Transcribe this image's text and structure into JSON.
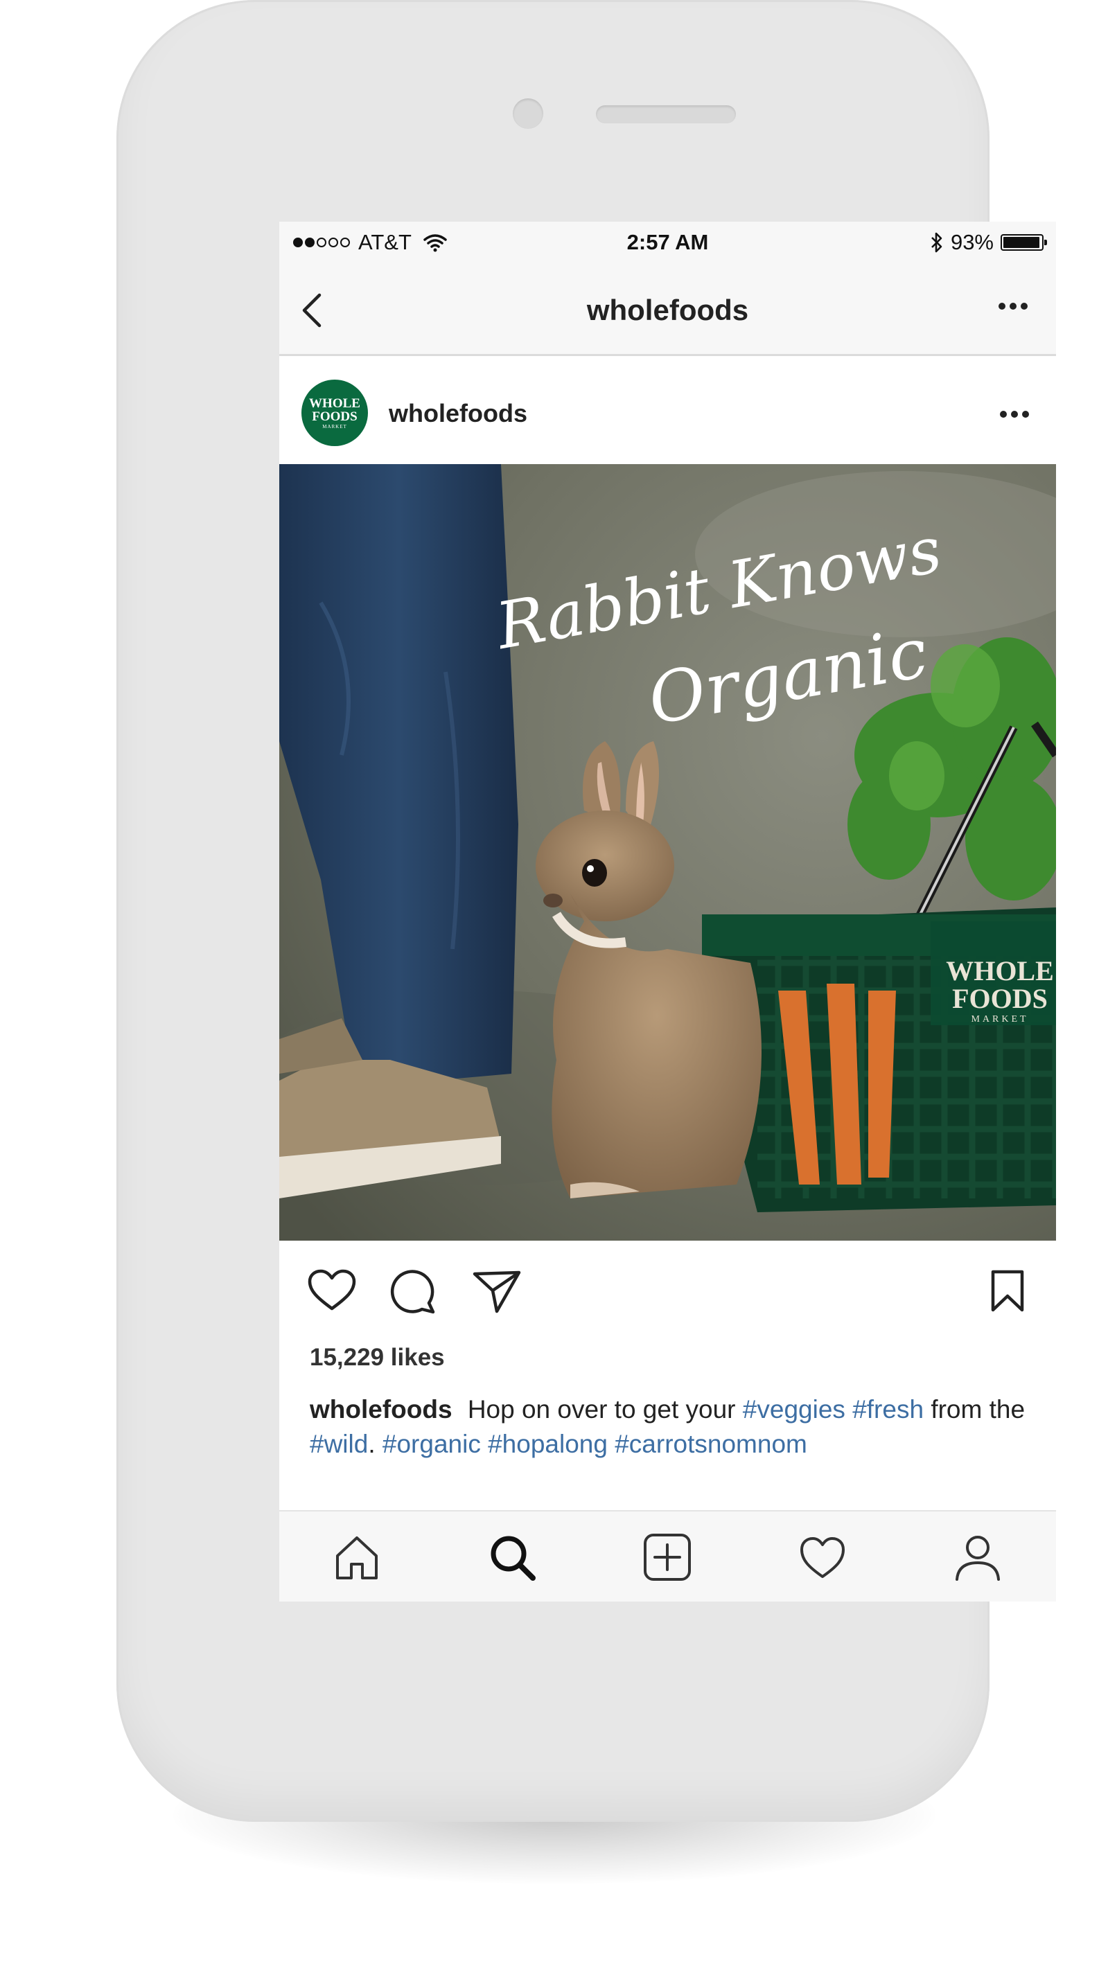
{
  "status_bar": {
    "carrier": "AT&T",
    "time": "2:57 AM",
    "battery": "93%",
    "battery_level": 0.93,
    "signal_bars_filled": 2,
    "signal_bars_total": 5
  },
  "nav": {
    "title": "wholefoods",
    "back_icon": "chevron-left-icon",
    "more_icon": "ellipsis-icon"
  },
  "post": {
    "username": "wholefoods",
    "avatar_logo": {
      "line1": "WHOLE",
      "line2": "FOODS",
      "line3": "MARKET",
      "color": "#0a6a3f"
    },
    "image": {
      "headline_line1": "Rabbit Knows",
      "headline_line2": "Organic",
      "basket_logo_line1": "WHOLE",
      "basket_logo_line2": "FOODS",
      "basket_logo_line3": "MARKET"
    },
    "likes": "15,229 likes",
    "caption": {
      "username": "wholefoods",
      "text_1": "Hop on over to get your",
      "tag_1": "#veggies",
      "tag_2": "#fresh",
      "text_2": "from the",
      "tag_3": "#wild",
      "text_3": ".",
      "tag_4": "#organic",
      "tag_5": "#hopalong",
      "tag_6": "#carrotsnomnom"
    }
  },
  "actions": [
    "heart-icon",
    "comment-icon",
    "share-icon",
    "bookmark-icon"
  ],
  "tab_bar": [
    "home-icon",
    "search-icon",
    "add-icon",
    "activity-icon",
    "profile-icon"
  ],
  "colors": {
    "hashtag": "#3d6ea3",
    "brand_green": "#0a6a3f",
    "phone_body": "#e7e7e7"
  }
}
